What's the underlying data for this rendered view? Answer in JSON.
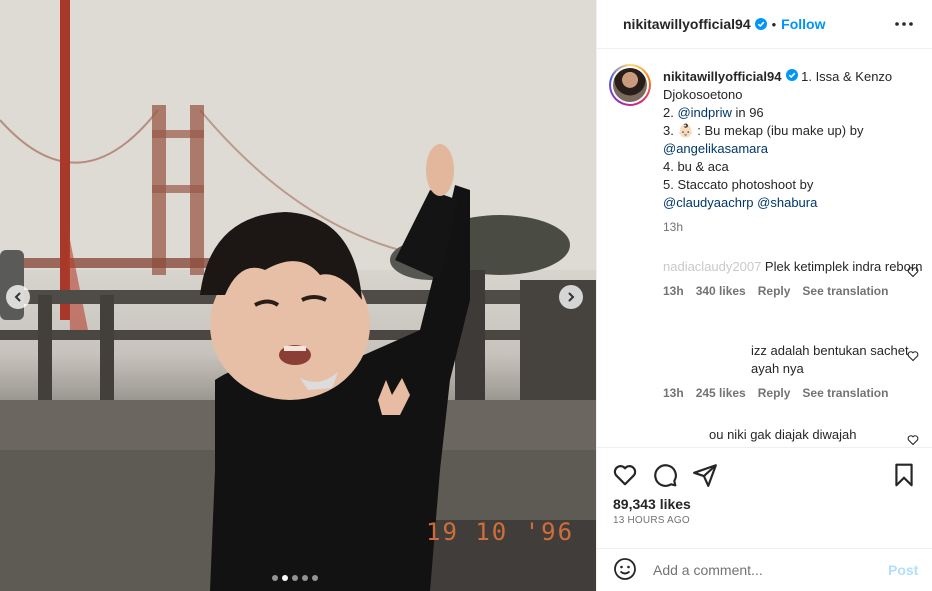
{
  "post": {
    "date_stamp": "19 10 '96",
    "carousel": {
      "total_slides": 5,
      "active_index": 1
    }
  },
  "header": {
    "username": "nikitawillyofficial94",
    "separator": "•",
    "follow_label": "Follow"
  },
  "caption": {
    "username": "nikitawillyofficial94",
    "line1": " 1. Issa & Kenzo Djokosoetono",
    "line2_prefix": "2. ",
    "line2_link": "@indpriw",
    "line2_suffix": " in 96",
    "line3_prefix": "3. ",
    "line3_emoji": "👶🏻",
    "line3_text": " : Bu mekap (ibu make up) by",
    "line3_link": "@angelikasamara",
    "line4": "4. bu & aca",
    "line5": "5. Staccato photoshoot by",
    "line5_link1": "@claudyaachrp",
    "line5_link2": "@shabura",
    "time": "13h"
  },
  "comments": [
    {
      "user": "nadiaclaudy2007",
      "text": " Plek ketimplek indra reborn",
      "time": "13h",
      "likes": "340 likes",
      "reply": "Reply",
      "translate": "See translation"
    },
    {
      "user": "",
      "text": "izz adalah bentukan sachet ayah nya",
      "time": "13h",
      "likes": "245 likes",
      "reply": "Reply",
      "translate": "See translation"
    },
    {
      "user": "",
      "text": "ou niki gak diajak diwajah",
      "time": "",
      "likes": "",
      "reply": "",
      "translate": ""
    }
  ],
  "stats": {
    "likes": "89,343 likes",
    "ago": "13 HOURS AGO"
  },
  "composer": {
    "placeholder": "Add a comment...",
    "post_label": "Post"
  },
  "colors": {
    "link": "#00376b",
    "follow": "#0095f6",
    "verified": "#0095f6",
    "stamp": "#e0743a"
  },
  "icons": [
    "verified-badge-icon",
    "more-options-icon",
    "chevron-left-icon",
    "chevron-right-icon",
    "heart-icon",
    "comment-icon",
    "share-icon",
    "bookmark-icon",
    "emoji-icon"
  ]
}
